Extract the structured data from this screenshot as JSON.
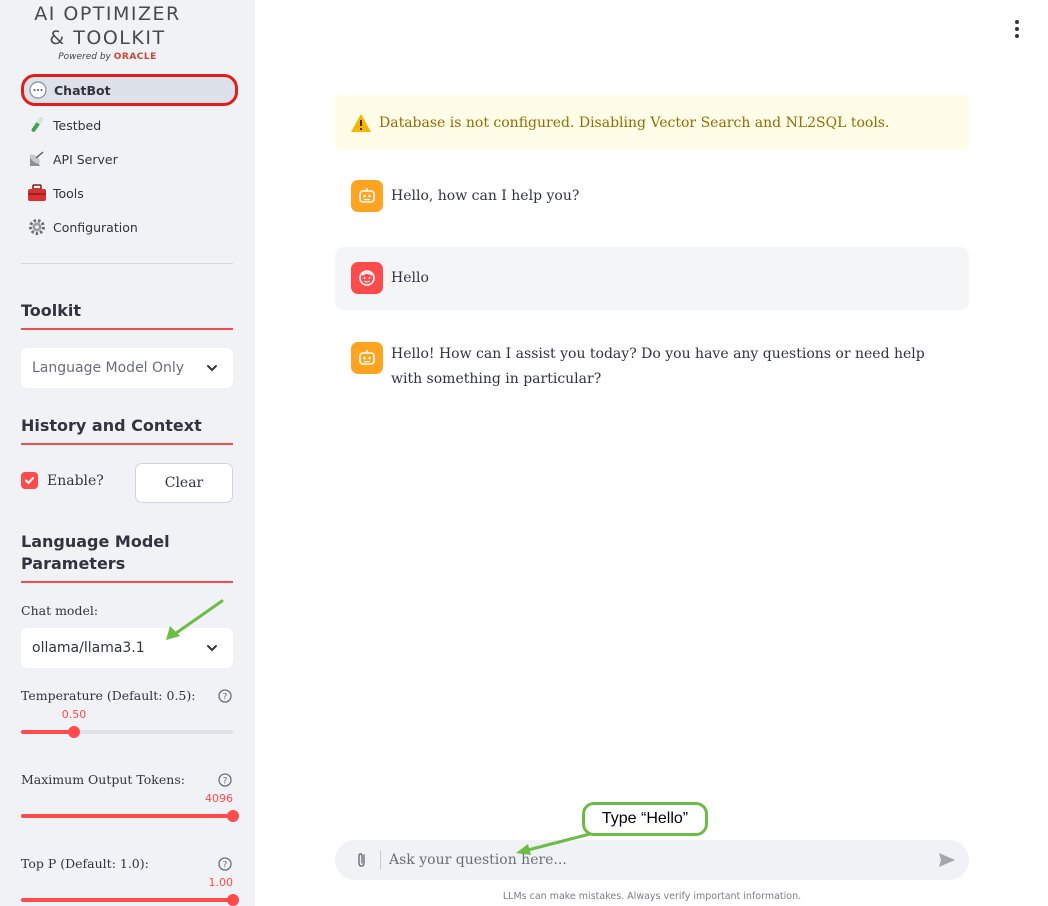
{
  "app": {
    "logo_line1": "AI OPTIMIZER",
    "logo_line2": "& TOOLKIT",
    "powered_by": "Powered by",
    "oracle": "ORACLE"
  },
  "nav": {
    "items": [
      {
        "label": "ChatBot",
        "icon": "chat-bubble-icon",
        "active": true
      },
      {
        "label": "Testbed",
        "icon": "test-tube-icon",
        "active": false
      },
      {
        "label": "API Server",
        "icon": "satellite-dish-icon",
        "active": false
      },
      {
        "label": "Tools",
        "icon": "toolbox-icon",
        "active": false
      },
      {
        "label": "Configuration",
        "icon": "gear-icon",
        "active": false
      }
    ]
  },
  "toolkit": {
    "title": "Toolkit",
    "selected": "Language Model Only"
  },
  "history": {
    "title": "History and Context",
    "enable_label": "Enable?",
    "enabled": true,
    "clear_label": "Clear"
  },
  "lm_params": {
    "title_line1": "Language Model",
    "title_line2": "Parameters",
    "chat_model_label": "Chat model:",
    "chat_model_value": "ollama/llama3.1",
    "temperature_label": "Temperature (Default: 0.5):",
    "temperature_value": "0.50",
    "temperature_fraction": 0.25,
    "max_tokens_label": "Maximum Output Tokens:",
    "max_tokens_value": "4096",
    "max_tokens_fraction": 1.0,
    "top_p_label": "Top P (Default: 1.0):",
    "top_p_value": "1.00",
    "top_p_fraction": 1.0
  },
  "warning": {
    "text": "Database is not configured. Disabling Vector Search and NL2SQL tools."
  },
  "messages": [
    {
      "role": "assistant",
      "text": "Hello, how can I help you?"
    },
    {
      "role": "user",
      "text": "Hello"
    },
    {
      "role": "assistant",
      "text": "Hello! How can I assist you today? Do you have any questions or need help with something in particular?"
    }
  ],
  "chat_input": {
    "placeholder": "Ask your question here..."
  },
  "disclaimer": "LLMs can make mistakes. Always verify important information.",
  "annotation": {
    "bubble_text": "Type “Hello”"
  },
  "colors": {
    "accent": "#ff4b4b",
    "annotation_red": "#e01e1e",
    "annotation_green": "#6cbd45",
    "bot_avatar": "#ffa421",
    "warning_bg": "#fffce7"
  }
}
